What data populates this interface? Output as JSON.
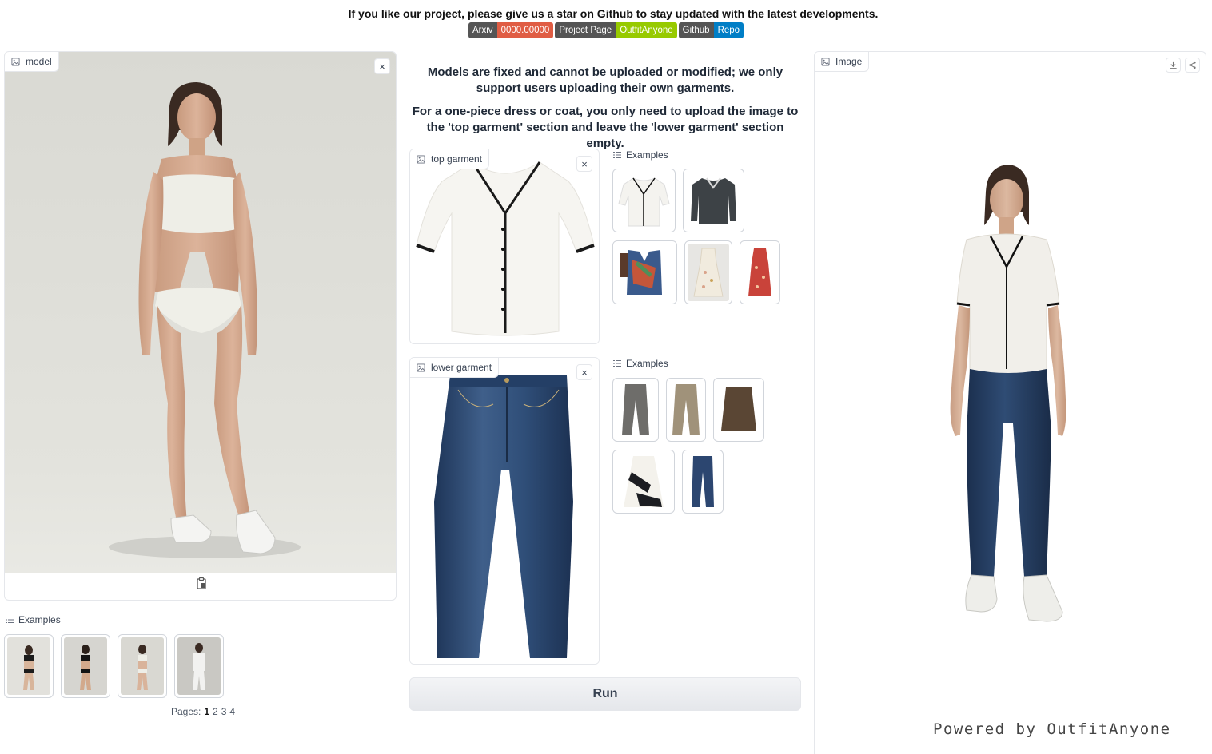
{
  "announcement": "If you like our project, please give us a star on Github to stay updated with the latest developments.",
  "badges": [
    {
      "left": "Arxiv",
      "right": "0000.00000",
      "color": "#e05d44"
    },
    {
      "left": "Project Page",
      "right": "OutfitAnyone",
      "color": "#97ca00"
    },
    {
      "left": "Github",
      "right": "Repo",
      "color": "#007ec6"
    }
  ],
  "model_panel": {
    "label": "model",
    "clear": "×",
    "paste_icon": "clipboard-icon"
  },
  "model_examples": {
    "label": "Examples",
    "pages_label": "Pages:",
    "pages": [
      "1",
      "2",
      "3",
      "4"
    ],
    "current_page": "1"
  },
  "notice": {
    "line1": "Models are fixed and cannot be uploaded or modified; we only support users uploading their own garments.",
    "line2": "For a one-piece dress or coat, you only need to upload the image to the 'top garment' section and leave the 'lower garment' section empty."
  },
  "top_garment": {
    "label": "top garment",
    "clear": "×"
  },
  "top_examples": {
    "label": "Examples"
  },
  "lower_garment": {
    "label": "lower garment",
    "clear": "×"
  },
  "lower_examples": {
    "label": "Examples"
  },
  "run_button": "Run",
  "output_panel": {
    "label": "Image",
    "watermark": "Powered by OutfitAnyone"
  }
}
